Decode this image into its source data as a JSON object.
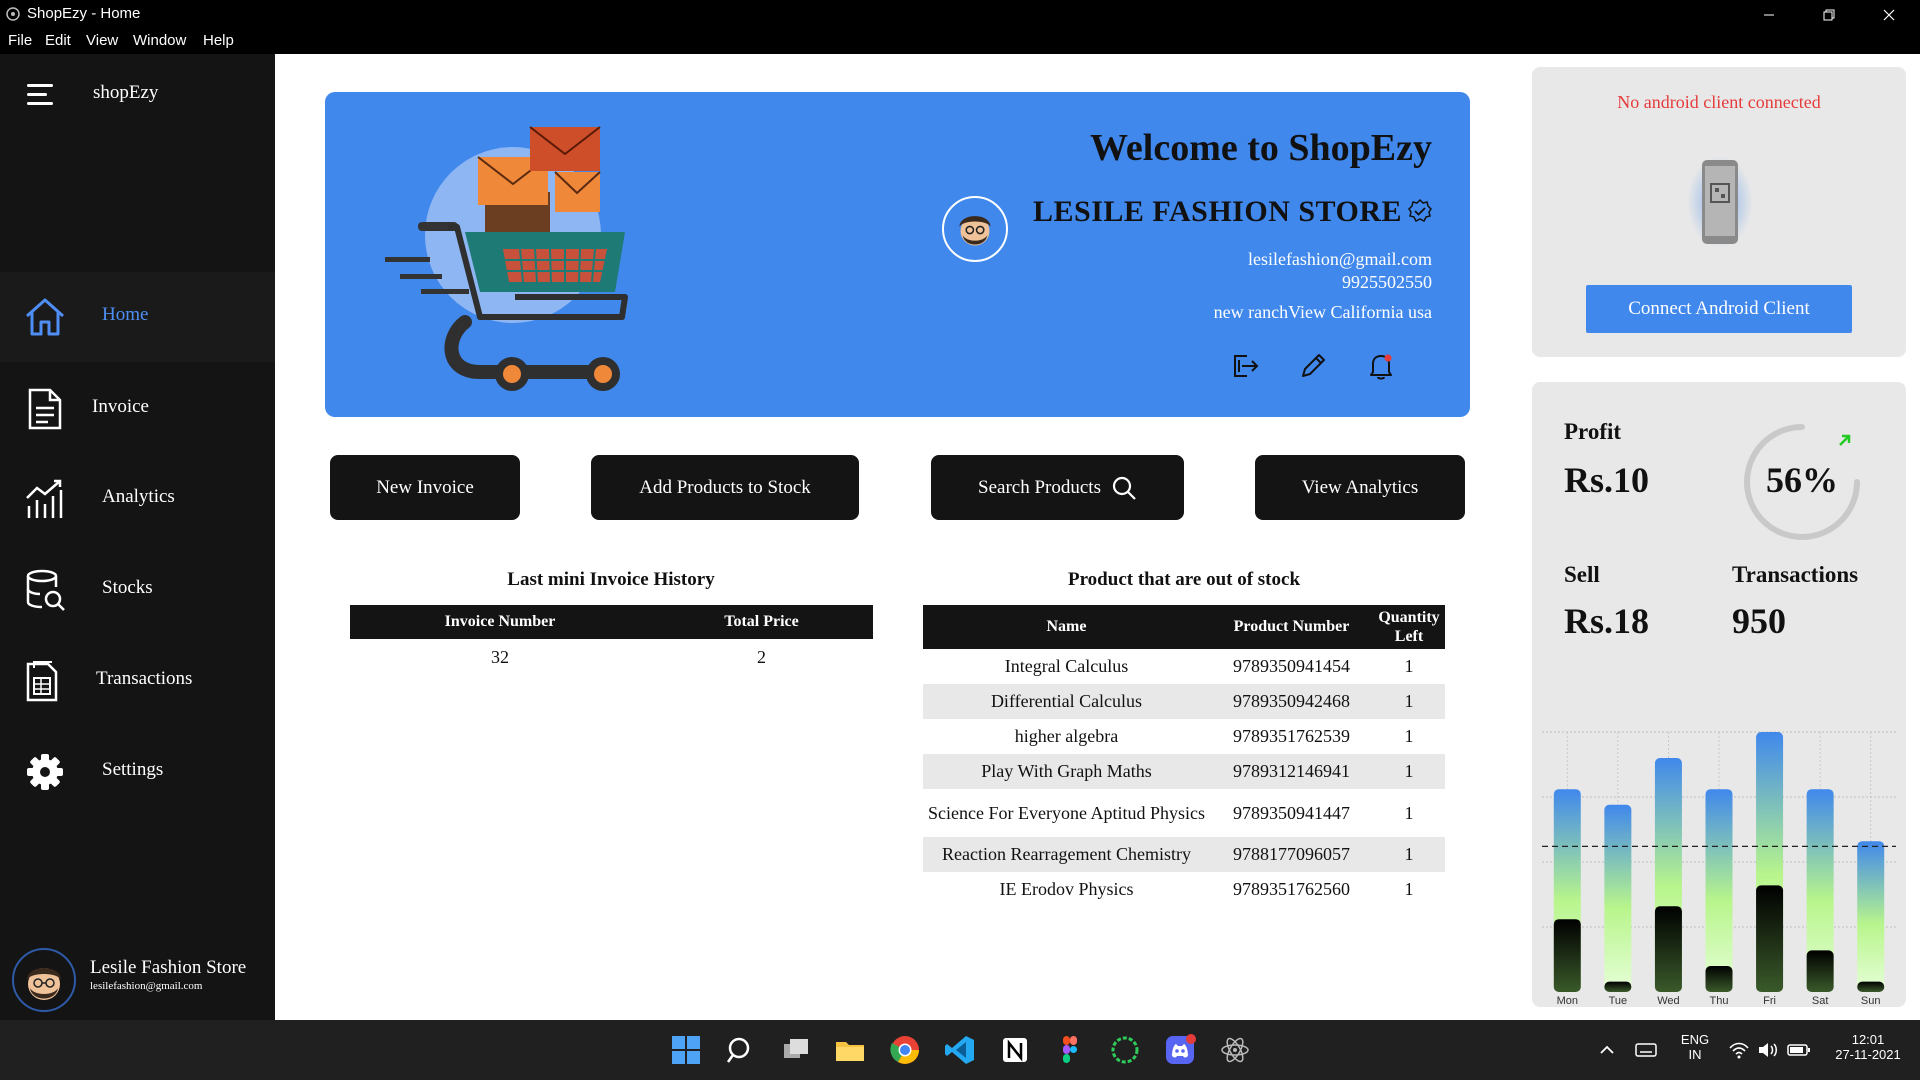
{
  "window": {
    "title": "ShopEzy - Home",
    "menu": [
      "File",
      "Edit",
      "View",
      "Window",
      "Help"
    ]
  },
  "sidebar": {
    "brand": "shopEzy",
    "items": [
      {
        "label": "Home",
        "icon": "home-icon",
        "active": true
      },
      {
        "label": "Invoice",
        "icon": "document-icon"
      },
      {
        "label": "Analytics",
        "icon": "analytics-icon"
      },
      {
        "label": "Stocks",
        "icon": "database-search-icon"
      },
      {
        "label": "Transactions",
        "icon": "receipt-icon"
      },
      {
        "label": "Settings",
        "icon": "gear-icon"
      }
    ],
    "profile": {
      "name": "Lesile Fashion Store",
      "email": "lesilefashion@gmail.com"
    }
  },
  "banner": {
    "welcome": "Welcome to ShopEzy",
    "store_name": "LESILE FASHION STORE",
    "email": "lesilefashion@gmail.com",
    "phone": "9925502550",
    "address": "new ranchView California usa"
  },
  "actions": {
    "new_invoice": "New Invoice",
    "add_products": "Add Products to Stock",
    "search_products": "Search Products",
    "view_analytics": "View Analytics"
  },
  "invoice_history": {
    "title": "Last mini Invoice History",
    "headers": [
      "Invoice Number",
      "Total Price"
    ],
    "rows": [
      [
        "32",
        "2"
      ]
    ]
  },
  "out_of_stock": {
    "title": "Product that are out of stock",
    "headers": [
      "Name",
      "Product Number",
      "Quantity Left"
    ],
    "rows": [
      [
        "Integral Calculus",
        "9789350941454",
        "1"
      ],
      [
        "Differential Calculus",
        "9789350942468",
        "1"
      ],
      [
        "higher algebra",
        "9789351762539",
        "1"
      ],
      [
        "Play With Graph Maths",
        "9789312146941",
        "1"
      ],
      [
        "Science For Everyone Aptitud Physics",
        "9789350941447",
        "1"
      ],
      [
        "Reaction Rearragement Chemistry",
        "9788177096057",
        "1"
      ],
      [
        "IE Erodov Physics",
        "9789351762560",
        "1"
      ]
    ]
  },
  "android": {
    "status": "No android client connected",
    "connect_label": "Connect Android Client"
  },
  "stats": {
    "profit_label": "Profit",
    "profit_value": "Rs.10",
    "percent": "56%",
    "percent_value": 56,
    "sell_label": "Sell",
    "sell_value": "Rs.18",
    "transactions_label": "Transactions",
    "transactions_value": "950"
  },
  "chart_data": {
    "type": "bar",
    "categories": [
      "Mon",
      "Tue",
      "Wed",
      "Thu",
      "Fri",
      "Sat",
      "Sun"
    ],
    "series": [
      {
        "values": [
          0.78,
          0.72,
          0.9,
          0.78,
          1.0,
          0.78,
          0.58
        ]
      },
      {
        "values": [
          0.28,
          0.04,
          0.33,
          0.1,
          0.41,
          0.16,
          0.04
        ]
      }
    ],
    "reference_line": 0.56,
    "colors": {
      "top": "#4088ec",
      "mid": "#b8f58c",
      "low": "#000000"
    }
  },
  "taskbar": {
    "lang": "ENG",
    "region": "IN",
    "time": "12:01",
    "date": "27-11-2021"
  }
}
